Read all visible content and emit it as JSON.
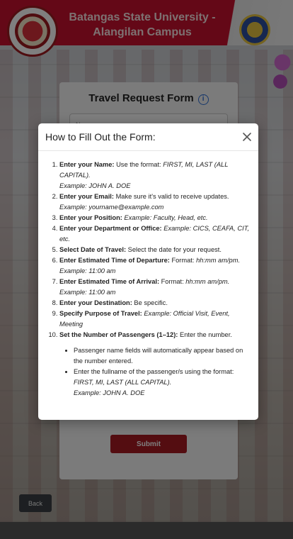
{
  "banner": {
    "title": "Batangas State University - Alangilan Campus"
  },
  "form": {
    "title": "Travel Request Form",
    "info_icon": "info-icon",
    "name_placeholder": "Name",
    "submit_label": "Submit",
    "back_label": "Back"
  },
  "modal": {
    "title": "How to Fill Out the Form:",
    "close_icon": "close-icon",
    "steps": [
      {
        "label": "Enter your Name:",
        "text": " Use the format: ",
        "italic": "FIRST, MI, LAST (ALL CAPITAL).",
        "example": "Example: JOHN A. DOE"
      },
      {
        "label": "Enter your Email:",
        "text": " Make sure it's valid to receive updates.",
        "example": "Example: yourname@example.com"
      },
      {
        "label": "Enter your Position:",
        "italic": " Example: Faculty, Head, etc."
      },
      {
        "label": "Enter your Department or Office:",
        "italic": " Example: CICS, CEAFA, CIT, etc."
      },
      {
        "label": "Select Date of Travel:",
        "text": " Select the date for your request."
      },
      {
        "label": "Enter Estimated Time of Departure:",
        "text": " Format: ",
        "italic": "hh:mm am/pm.",
        "example": "Example: 11:00 am"
      },
      {
        "label": "Enter Estimated Time of Arrival:",
        "text": " Format: ",
        "italic": "hh:mm am/pm.",
        "example": "Example: 11:00 am"
      },
      {
        "label": "Enter your Destination:",
        "text": " Be specific."
      },
      {
        "label": "Specify Purpose of Travel:",
        "italic": " Example: Official Visit, Event, Meeting"
      },
      {
        "label": "Set the Number of Passengers (1–12):",
        "text": " Enter the number."
      }
    ],
    "passenger_notes": [
      {
        "text": "Passenger name fields will automatically appear based on the number entered."
      },
      {
        "text": "Enter the fullname of the passenger/s using the format: ",
        "italic": "FIRST, MI, LAST (ALL CAPITAL).",
        "example": "Example: JOHN A. DOE"
      }
    ]
  }
}
